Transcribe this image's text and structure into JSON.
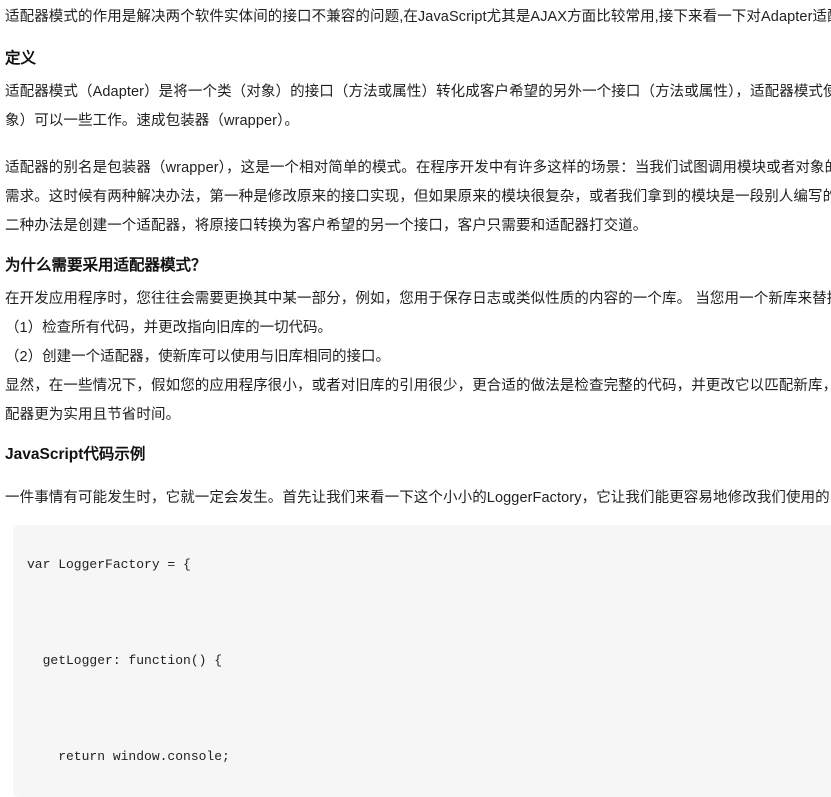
{
  "article": {
    "intro_paragraph": "适配器模式的作用是解决两个软件实体间的接口不兼容的问题,在JavaScript尤其是AJAX方面比较常用,接下来看一下对Adapter适配器模式的介绍。",
    "sections": [
      {
        "heading": "定义",
        "paragraphs": [
          "适配器模式（Adapter）是将一个类（对象）的接口（方法或属性）转化成客户希望的另外一个接口（方法或属性），适配器模式使得原本由于接口不兼容而不能一起工作的那些类（对象）可以一些工作。速成包装器（wrapper）。",
          "适配器的别名是包装器（wrapper），这是一个相对简单的模式。在程序开发中有许多这样的场景：当我们试图调用模块或者对象的某个接口时，却发现这个接口的格式并不符合目前的需求。这时候有两种解决办法，第一种是修改原来的接口实现，但如果原来的模块很复杂，或者我们拿到的模块是一段别人编写的经过压缩的代码，修改原接口就显得不太现实了。第二种办法是创建一个适配器，将原接口转换为客户希望的另一个接口，客户只需要和适配器打交道。"
        ]
      },
      {
        "heading": "为什么需要采用适配器模式？",
        "paragraphs": [
          "在开发应用程序时，您往往会需要更换其中某一部分，例如，您用于保存日志或类似性质的内容的一个库。 当您用一个新库来替换它时，您有两种选择："
        ],
        "list_items": [
          "（1）检查所有代码，并更改指向旧库的一切代码。",
          "（2）创建一个适配器，使新库可以使用与旧库相同的接口。"
        ],
        "closing_paragraph": "显然，在一些情况下，假如您的应用程序很小，或者对旧库的引用很少，更合适的做法是检查完整的代码，并更改它以匹配新库，而不是创建适配器。但在大多数情况下，创建一个适配器更为实用且节省时间。"
      },
      {
        "heading": "JavaScript代码示例",
        "paragraphs": [
          "一件事情有可能发生时，它就一定会发生。首先让我们来看一下这个小小的LoggerFactory，它让我们能更容易地修改我们使用的日志记录库。"
        ],
        "code": "var LoggerFactory = {\n\n  getLogger: function() {\n\n    return window.console;"
      }
    ]
  },
  "colors": {
    "page_background": "#ffffff",
    "text": "#1f1f1f",
    "heading": "#111111",
    "code_background": "#f6f6f6",
    "code_text": "#222222"
  }
}
